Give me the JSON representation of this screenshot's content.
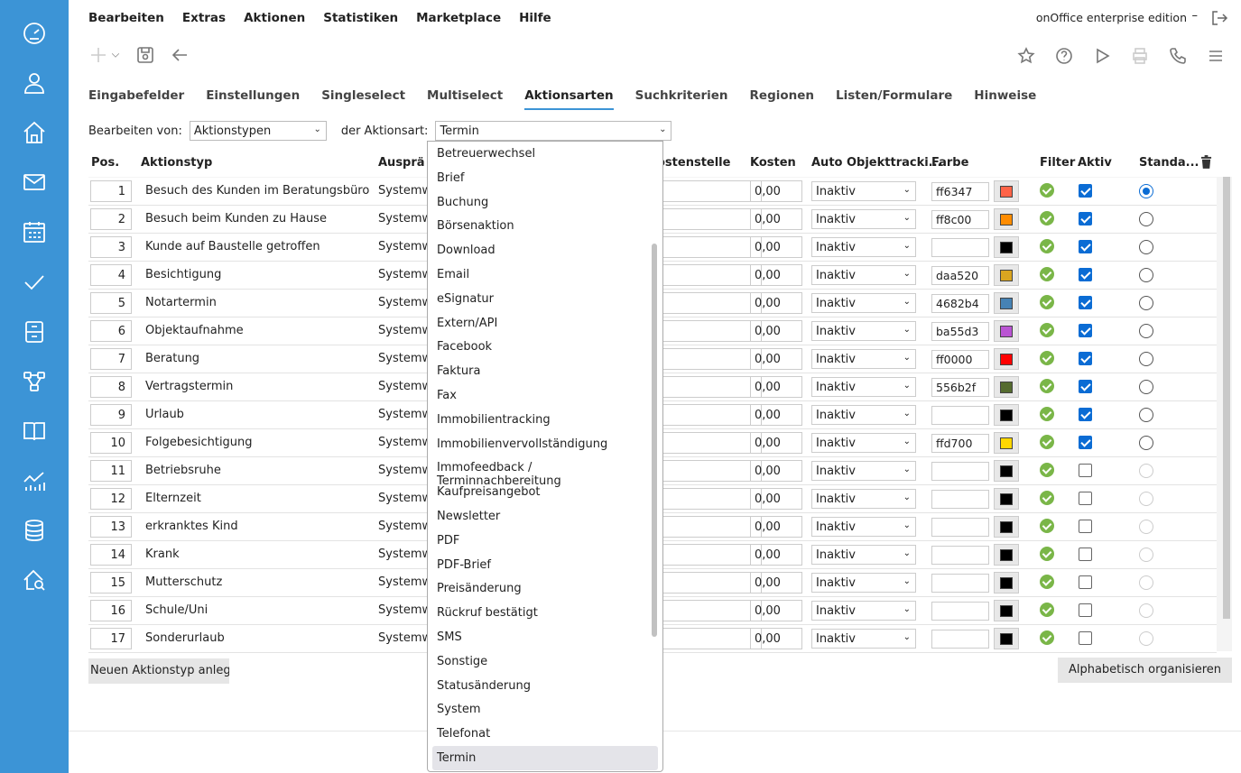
{
  "menu": [
    "Bearbeiten",
    "Extras",
    "Aktionen",
    "Statistiken",
    "Marketplace",
    "Hilfe"
  ],
  "edition": "onOffice enterprise edition",
  "edition_sep": "–",
  "tabs": [
    "Eingabefelder",
    "Einstellungen",
    "Singleselect",
    "Multiselect",
    "Aktionsarten",
    "Suchkriterien",
    "Regionen",
    "Listen/Formulare",
    "Hinweise"
  ],
  "active_tab": "Aktionsarten",
  "filter": {
    "label1": "Bearbeiten von:",
    "value1": "Aktionstypen",
    "label2": "der Aktionsart:",
    "value2": "Termin"
  },
  "columns": {
    "pos": "Pos.",
    "aktionstyp": "Aktionstyp",
    "auspraegung": "Ausprä",
    "kostenstelle": "ostenstelle",
    "kosten": "Kosten",
    "auto": "Auto Objekttracki...",
    "farbe": "Farbe",
    "filter": "Filter",
    "aktiv": "Aktiv",
    "standard": "Standa..."
  },
  "rows": [
    {
      "pos": "1",
      "name": "Besuch des Kunden im Beratungsbüro",
      "auspr": "Systemw",
      "kosten": "0,00",
      "auto": "Inaktiv",
      "farbe": "ff6347",
      "color": "#ff6347",
      "aktiv": true,
      "std": "on"
    },
    {
      "pos": "2",
      "name": "Besuch beim Kunden zu Hause",
      "auspr": "Systemw",
      "kosten": "0,00",
      "auto": "Inaktiv",
      "farbe": "ff8c00",
      "color": "#ff8c00",
      "aktiv": true,
      "std": "off"
    },
    {
      "pos": "3",
      "name": "Kunde auf Baustelle getroffen",
      "auspr": "Systemw",
      "kosten": "0,00",
      "auto": "Inaktiv",
      "farbe": "",
      "color": "#000000",
      "aktiv": true,
      "std": "off"
    },
    {
      "pos": "4",
      "name": "Besichtigung",
      "auspr": "Systemw",
      "kosten": "0,00",
      "auto": "Inaktiv",
      "farbe": "daa520",
      "color": "#daa520",
      "aktiv": true,
      "std": "off"
    },
    {
      "pos": "5",
      "name": "Notartermin",
      "auspr": "Systemw",
      "kosten": "0,00",
      "auto": "Inaktiv",
      "farbe": "4682b4",
      "color": "#4682b4",
      "aktiv": true,
      "std": "off"
    },
    {
      "pos": "6",
      "name": "Objektaufnahme",
      "auspr": "Systemw",
      "kosten": "0,00",
      "auto": "Inaktiv",
      "farbe": "ba55d3",
      "color": "#ba55d3",
      "aktiv": true,
      "std": "off"
    },
    {
      "pos": "7",
      "name": "Beratung",
      "auspr": "Systemw",
      "kosten": "0,00",
      "auto": "Inaktiv",
      "farbe": "ff0000",
      "color": "#ff0000",
      "aktiv": true,
      "std": "off"
    },
    {
      "pos": "8",
      "name": "Vertragstermin",
      "auspr": "Systemw",
      "kosten": "0,00",
      "auto": "Inaktiv",
      "farbe": "556b2f",
      "color": "#556b2f",
      "aktiv": true,
      "std": "off"
    },
    {
      "pos": "9",
      "name": "Urlaub",
      "auspr": "Systemw",
      "kosten": "0,00",
      "auto": "Inaktiv",
      "farbe": "",
      "color": "#000000",
      "aktiv": true,
      "std": "off"
    },
    {
      "pos": "10",
      "name": "Folgebesichtigung",
      "auspr": "Systemw",
      "kosten": "0,00",
      "auto": "Inaktiv",
      "farbe": "ffd700",
      "color": "#ffd700",
      "aktiv": true,
      "std": "off"
    },
    {
      "pos": "11",
      "name": "Betriebsruhe",
      "auspr": "Systemw",
      "kosten": "0,00",
      "auto": "Inaktiv",
      "farbe": "",
      "color": "#000000",
      "aktiv": false,
      "std": "dis"
    },
    {
      "pos": "12",
      "name": "Elternzeit",
      "auspr": "Systemw",
      "kosten": "0,00",
      "auto": "Inaktiv",
      "farbe": "",
      "color": "#000000",
      "aktiv": false,
      "std": "dis"
    },
    {
      "pos": "13",
      "name": "erkranktes Kind",
      "auspr": "Systemw",
      "kosten": "0,00",
      "auto": "Inaktiv",
      "farbe": "",
      "color": "#000000",
      "aktiv": false,
      "std": "dis"
    },
    {
      "pos": "14",
      "name": "Krank",
      "auspr": "Systemw",
      "kosten": "0,00",
      "auto": "Inaktiv",
      "farbe": "",
      "color": "#000000",
      "aktiv": false,
      "std": "dis"
    },
    {
      "pos": "15",
      "name": "Mutterschutz",
      "auspr": "Systemw",
      "kosten": "0,00",
      "auto": "Inaktiv",
      "farbe": "",
      "color": "#000000",
      "aktiv": false,
      "std": "dis"
    },
    {
      "pos": "16",
      "name": "Schule/Uni",
      "auspr": "Systemw",
      "kosten": "0,00",
      "auto": "Inaktiv",
      "farbe": "",
      "color": "#000000",
      "aktiv": false,
      "std": "dis"
    },
    {
      "pos": "17",
      "name": "Sonderurlaub",
      "auspr": "Systemw",
      "kosten": "0,00",
      "auto": "Inaktiv",
      "farbe": "",
      "color": "#000000",
      "aktiv": false,
      "std": "dis"
    }
  ],
  "buttons": {
    "new": "Neuen Aktionstyp anlegen",
    "alpha": "Alphabetisch organisieren"
  },
  "dropdown": [
    "Betreuerwechsel",
    "Brief",
    "Buchung",
    "Börsenaktion",
    "Download",
    "Email",
    "eSignatur",
    "Extern/API",
    "Facebook",
    "Faktura",
    "Fax",
    "Immobilientracking",
    "Immobilienvervollständigung",
    "Immofeedback / Terminnachbereitung",
    "Kaufpreisangebot",
    "Newsletter",
    "PDF",
    "PDF-Brief",
    "Preisänderung",
    "Rückruf bestätigt",
    "SMS",
    "Sonstige",
    "Statusänderung",
    "System",
    "Telefonat",
    "Termin"
  ],
  "dropdown_selected": "Termin",
  "sidebar_icons": [
    "dashboard-icon",
    "user-icon",
    "home-icon",
    "mail-icon",
    "calendar-icon",
    "check-icon",
    "cabinet-icon",
    "workflow-icon",
    "book-icon",
    "chart-icon",
    "database-icon",
    "house-search-icon"
  ]
}
